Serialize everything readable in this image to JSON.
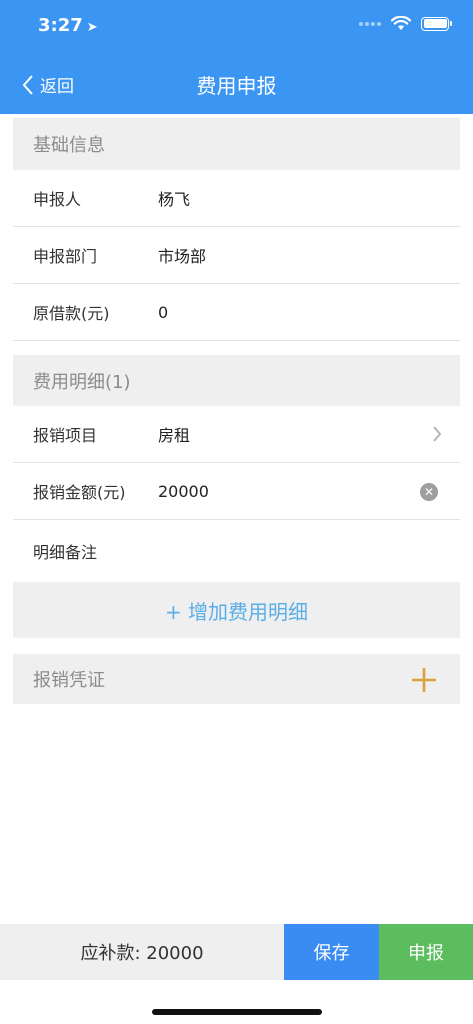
{
  "status_bar": {
    "time": "3:27",
    "location_icon": "location-arrow-icon",
    "wifi_icon": "wifi-icon",
    "battery_icon": "battery-icon"
  },
  "nav": {
    "back_label": "返回",
    "title": "费用申报"
  },
  "basic_info": {
    "title": "基础信息",
    "rows": [
      {
        "label": "申报人",
        "value": "杨飞"
      },
      {
        "label": "申报部门",
        "value": "市场部"
      },
      {
        "label": "原借款(元)",
        "value": "0"
      }
    ]
  },
  "expense_detail": {
    "title": "费用明细(1)",
    "rows": [
      {
        "label": "报销项目",
        "value": "房租"
      },
      {
        "label": "报销金额(元)",
        "value": "20000"
      },
      {
        "label": "明细备注",
        "value": ""
      }
    ],
    "add_label": "+ 增加费用明细"
  },
  "voucher": {
    "title": "报销凭证",
    "add_icon": "plus-icon"
  },
  "bottom": {
    "due_label": "应补款: 20000",
    "save_label": "保存",
    "submit_label": "申报"
  },
  "colors": {
    "header": "#3b96f3",
    "save": "#3a8cf2",
    "submit": "#5bbd5e",
    "accent_plus": "#d8a03a",
    "link": "#5aaee8"
  }
}
